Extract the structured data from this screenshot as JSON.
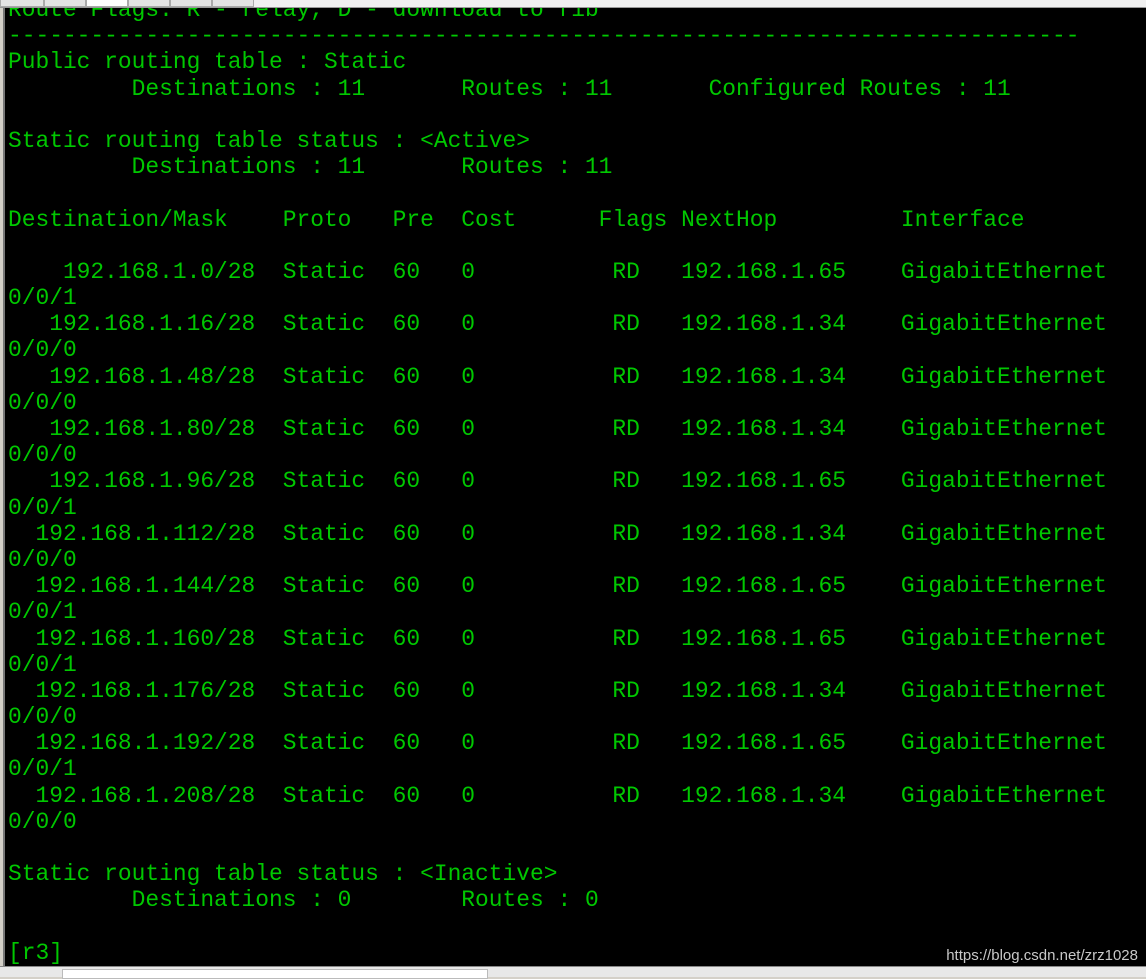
{
  "colors": {
    "text": "#00c800",
    "background": "#000000"
  },
  "header_lines": [
    "Route Flags: R - relay, D - download to fib",
    "------------------------------------------------------------------------------",
    "Public routing table : Static",
    "         Destinations : 11       Routes : 11       Configured Routes : 11",
    "",
    "Static routing table status : <Active>",
    "         Destinations : 11       Routes : 11",
    "",
    "Destination/Mask    Proto   Pre  Cost      Flags NextHop         Interface",
    ""
  ],
  "routes": [
    {
      "dest": "192.168.1.0/28",
      "proto": "Static",
      "pre": "60",
      "cost": "0",
      "flags": "RD",
      "nexthop": "192.168.1.65",
      "iface": "GigabitEthernet",
      "iface_cont": "0/0/1"
    },
    {
      "dest": "192.168.1.16/28",
      "proto": "Static",
      "pre": "60",
      "cost": "0",
      "flags": "RD",
      "nexthop": "192.168.1.34",
      "iface": "GigabitEthernet",
      "iface_cont": "0/0/0"
    },
    {
      "dest": "192.168.1.48/28",
      "proto": "Static",
      "pre": "60",
      "cost": "0",
      "flags": "RD",
      "nexthop": "192.168.1.34",
      "iface": "GigabitEthernet",
      "iface_cont": "0/0/0"
    },
    {
      "dest": "192.168.1.80/28",
      "proto": "Static",
      "pre": "60",
      "cost": "0",
      "flags": "RD",
      "nexthop": "192.168.1.34",
      "iface": "GigabitEthernet",
      "iface_cont": "0/0/0"
    },
    {
      "dest": "192.168.1.96/28",
      "proto": "Static",
      "pre": "60",
      "cost": "0",
      "flags": "RD",
      "nexthop": "192.168.1.65",
      "iface": "GigabitEthernet",
      "iface_cont": "0/0/1"
    },
    {
      "dest": "192.168.1.112/28",
      "proto": "Static",
      "pre": "60",
      "cost": "0",
      "flags": "RD",
      "nexthop": "192.168.1.34",
      "iface": "GigabitEthernet",
      "iface_cont": "0/0/0"
    },
    {
      "dest": "192.168.1.144/28",
      "proto": "Static",
      "pre": "60",
      "cost": "0",
      "flags": "RD",
      "nexthop": "192.168.1.65",
      "iface": "GigabitEthernet",
      "iface_cont": "0/0/1"
    },
    {
      "dest": "192.168.1.160/28",
      "proto": "Static",
      "pre": "60",
      "cost": "0",
      "flags": "RD",
      "nexthop": "192.168.1.65",
      "iface": "GigabitEthernet",
      "iface_cont": "0/0/1"
    },
    {
      "dest": "192.168.1.176/28",
      "proto": "Static",
      "pre": "60",
      "cost": "0",
      "flags": "RD",
      "nexthop": "192.168.1.34",
      "iface": "GigabitEthernet",
      "iface_cont": "0/0/0"
    },
    {
      "dest": "192.168.1.192/28",
      "proto": "Static",
      "pre": "60",
      "cost": "0",
      "flags": "RD",
      "nexthop": "192.168.1.65",
      "iface": "GigabitEthernet",
      "iface_cont": "0/0/1"
    },
    {
      "dest": "192.168.1.208/28",
      "proto": "Static",
      "pre": "60",
      "cost": "0",
      "flags": "RD",
      "nexthop": "192.168.1.34",
      "iface": "GigabitEthernet",
      "iface_cont": "0/0/0"
    }
  ],
  "footer_lines": [
    "",
    "Static routing table status : <Inactive>",
    "         Destinations : 0        Routes : 0",
    "",
    "[r3]"
  ],
  "watermark": "https://blog.csdn.net/zrz1028"
}
